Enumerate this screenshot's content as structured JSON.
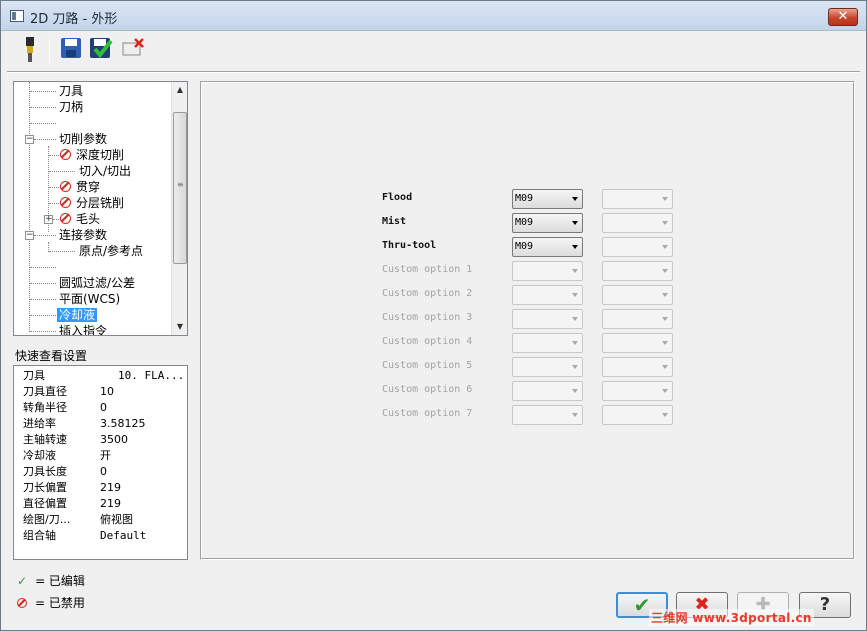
{
  "window": {
    "title": "2D 刀路 - 外形",
    "close_glyph": "✕"
  },
  "toolbar": {
    "icons": [
      "tool-icon",
      "save-icon",
      "save-green-icon",
      "delete-icon"
    ]
  },
  "tree": {
    "items": [
      {
        "label": "刀具"
      },
      {
        "label": "刀柄"
      },
      {
        "label": ""
      },
      {
        "label": "切削参数"
      },
      {
        "label": "深度切削"
      },
      {
        "label": "切入/切出"
      },
      {
        "label": "贯穿"
      },
      {
        "label": "分层铣削"
      },
      {
        "label": "毛头"
      },
      {
        "label": "连接参数"
      },
      {
        "label": "原点/参考点"
      },
      {
        "label": ""
      },
      {
        "label": "圆弧过滤/公差"
      },
      {
        "label": "平面(WCS)"
      },
      {
        "label": "冷却液"
      },
      {
        "label": "插入指令"
      }
    ],
    "expand_minus": "−",
    "expand_plus": "+"
  },
  "quick_view": {
    "label": "快速查看设置",
    "rows": [
      {
        "k": "刀具",
        "v": "10. FLA..."
      },
      {
        "k": "刀具直径",
        "v": "10"
      },
      {
        "k": "转角半径",
        "v": "0"
      },
      {
        "k": "进给率",
        "v": "3.58125"
      },
      {
        "k": "主轴转速",
        "v": "3500"
      },
      {
        "k": "冷却液",
        "v": "开"
      },
      {
        "k": "刀具长度",
        "v": "0"
      },
      {
        "k": "刀长偏置",
        "v": "219"
      },
      {
        "k": "直径偏置",
        "v": "219"
      },
      {
        "k": "绘图/刀...",
        "v": "俯视图"
      },
      {
        "k": "组合轴",
        "v": "Default"
      }
    ]
  },
  "legend": {
    "edited": "= 已编辑",
    "disabled": "= 已禁用",
    "check_glyph": "✓"
  },
  "coolant": {
    "rows": [
      {
        "label": "Flood",
        "value": "M09",
        "enabled": true
      },
      {
        "label": "Mist",
        "value": "M09",
        "enabled": true
      },
      {
        "label": "Thru-tool",
        "value": "M09",
        "enabled": true
      },
      {
        "label": "Custom option 1",
        "value": "",
        "enabled": false
      },
      {
        "label": "Custom option 2",
        "value": "",
        "enabled": false
      },
      {
        "label": "Custom option 3",
        "value": "",
        "enabled": false
      },
      {
        "label": "Custom option 4",
        "value": "",
        "enabled": false
      },
      {
        "label": "Custom option 5",
        "value": "",
        "enabled": false
      },
      {
        "label": "Custom option 6",
        "value": "",
        "enabled": false
      },
      {
        "label": "Custom option 7",
        "value": "",
        "enabled": false
      }
    ]
  },
  "buttons": {
    "ok_glyph": "✔",
    "cancel_glyph": "✖",
    "add_glyph": "✚",
    "help_glyph": "?"
  },
  "watermark": "三维网 www.3dportal.cn"
}
